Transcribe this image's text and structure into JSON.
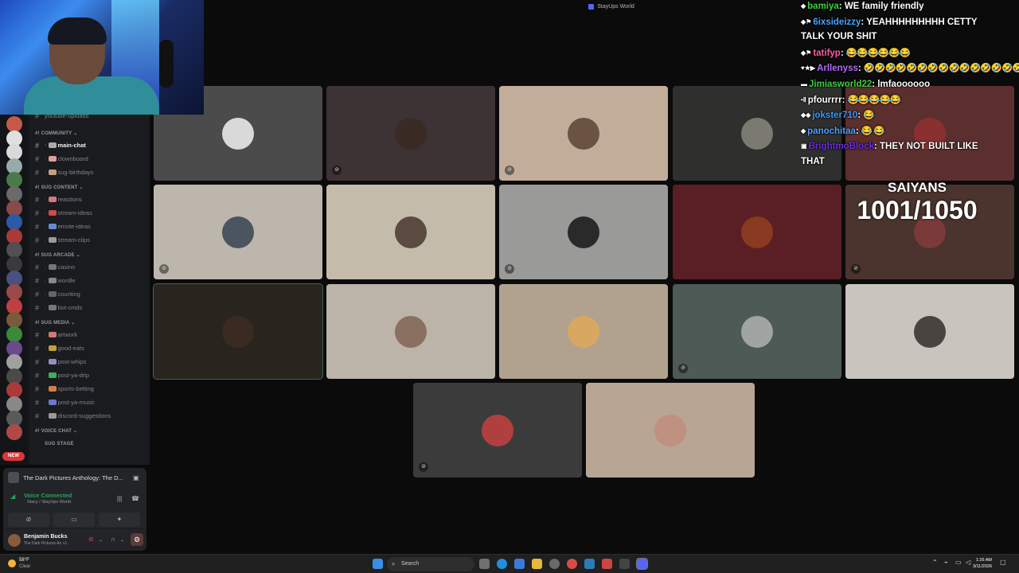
{
  "window": {
    "title": "StayUps World"
  },
  "server_rail": {
    "badges": [
      "",
      "",
      "",
      "",
      "",
      "",
      "",
      "",
      "",
      "",
      "",
      "",
      "",
      "",
      "",
      "",
      "",
      "",
      "",
      "",
      "",
      "",
      ""
    ],
    "new_label": "NEW"
  },
  "channels": {
    "top_partial": "youtube-uploads",
    "categories": [
      {
        "name": "COMMUNITY",
        "items": [
          {
            "label": "main-chat",
            "active": true
          },
          {
            "label": "clownboard",
            "active": false
          },
          {
            "label": "sug-birthdays",
            "active": false
          }
        ]
      },
      {
        "name": "SUG CONTENT",
        "items": [
          {
            "label": "reactions",
            "active": false
          },
          {
            "label": "stream-ideas",
            "active": false
          },
          {
            "label": "emote-ideas",
            "active": false
          },
          {
            "label": "stream-clips",
            "active": false
          }
        ]
      },
      {
        "name": "SUG ARCADE",
        "items": [
          {
            "label": "casino",
            "active": false
          },
          {
            "label": "wordle",
            "active": false
          },
          {
            "label": "counting",
            "active": false
          },
          {
            "label": "bot-cmds",
            "active": false
          }
        ]
      },
      {
        "name": "SUG MEDIA",
        "items": [
          {
            "label": "artwork",
            "active": false
          },
          {
            "label": "good-eats",
            "active": false
          },
          {
            "label": "post-whips",
            "active": false
          },
          {
            "label": "post-ya-drip",
            "active": false
          },
          {
            "label": "sports-betting",
            "active": false
          },
          {
            "label": "post-ya-music",
            "active": false
          },
          {
            "label": "discord-suggestions",
            "active": false
          }
        ]
      },
      {
        "name": "VOICE CHAT",
        "items": []
      }
    ],
    "stage_label": "SUG STAGE"
  },
  "voice_panel": {
    "activity": "The Dark Pictures Anthology: The D...",
    "status": "Voice Connected",
    "channel": "Stacy / StayUps World",
    "user_name": "Benjamin Bucks",
    "user_status": "The Dark Pictures An +1"
  },
  "voice_grid": {
    "tiles": [
      {
        "bg": "#4b4b4c",
        "av": "#d9d9d9",
        "muted": false,
        "selected": false
      },
      {
        "bg": "#3d3334",
        "av": "#3a2a24",
        "muted": true,
        "selected": false
      },
      {
        "bg": "#c1ad9a",
        "av": "#6a5342",
        "muted": true,
        "selected": false
      },
      {
        "bg": "#2f2f2e",
        "av": "#7a7a70",
        "muted": false,
        "selected": false
      },
      {
        "bg": "#5c2f2f",
        "av": "#8a3030",
        "muted": false,
        "selected": false
      },
      {
        "bg": "#bdb6ac",
        "av": "#4a5560",
        "muted": true,
        "selected": false
      },
      {
        "bg": "#c4bbab",
        "av": "#5a4a40",
        "muted": false,
        "selected": false
      },
      {
        "bg": "#9a9a99",
        "av": "#2a2a2a",
        "muted": true,
        "selected": false
      },
      {
        "bg": "#5a1f24",
        "av": "#8a3a20",
        "muted": false,
        "selected": false
      },
      {
        "bg": "#4a342d",
        "av": "#7a3a3a",
        "muted": true,
        "selected": false
      },
      {
        "bg": "#2a241f",
        "av": "#3a2a22",
        "muted": false,
        "selected": true
      },
      {
        "bg": "#bcb3a9",
        "av": "#8a7060",
        "muted": false,
        "selected": false
      },
      {
        "bg": "#b0a28e",
        "av": "#d8a860",
        "muted": false,
        "selected": false
      },
      {
        "bg": "#4d5a55",
        "av": "#a0a4a2",
        "muted": true,
        "selected": false
      },
      {
        "bg": "#c9c5be",
        "av": "#4a4440",
        "muted": false,
        "selected": false
      },
      {
        "bg": "#3c3b3b",
        "av": "#b04040",
        "muted": true,
        "selected": false
      },
      {
        "bg": "#b8a594",
        "av": "#c09080",
        "muted": false,
        "selected": false
      }
    ]
  },
  "chat": {
    "messages": [
      {
        "user": "bamiya",
        "color": "#3ecf3e",
        "text": "WE family friendly",
        "badges": "◆"
      },
      {
        "user": "6ixsideizzy",
        "color": "#4aa3ff",
        "text": "YEAHHHHHHHHH CETTY",
        "badges": "◆⚑"
      },
      {
        "user": "",
        "color": "#ffffff",
        "text": "TALK YOUR SHIT",
        "badges": ""
      },
      {
        "user": "tatifyp",
        "color": "#ff5aa8",
        "text": "😂😂😂😂😂😂",
        "badges": "◆⚑"
      },
      {
        "user": "Arllenyss",
        "color": "#b06cff",
        "text": "🤣🤣🤣🤣🤣🤣🤣🤣🤣🤣🤣🤣🤣🤣🤣🤣",
        "badges": "♥★▶"
      },
      {
        "user": "Jimiasworld22",
        "color": "#3ecf3e",
        "text": "lmfaoooooo",
        "badges": "▬"
      },
      {
        "user": "pfourrrr",
        "color": "#ffffff",
        "text": "😂😂😂😂😂",
        "badges": "•Ⅱ"
      },
      {
        "user": "jokster710",
        "color": "#3a9bff",
        "text": "😂",
        "badges": "◆◆"
      },
      {
        "user": "panochitaa",
        "color": "#4aa3ff",
        "text": "😂 😂",
        "badges": "◆"
      },
      {
        "user": "BrightmoBlock",
        "color": "#6b2fd9",
        "text": "THEY NOT BUILT LIKE",
        "badges": "▣"
      },
      {
        "user": "",
        "color": "#ffffff",
        "text": "THAT",
        "badges": ""
      }
    ]
  },
  "counter": {
    "title": "SAIYANS",
    "value": "1001/1050"
  },
  "taskbar": {
    "weather_temp": "58°F",
    "weather_cond": "Clear",
    "search_placeholder": "Search",
    "time": "1:26 AM",
    "date": "3/11/2026"
  }
}
